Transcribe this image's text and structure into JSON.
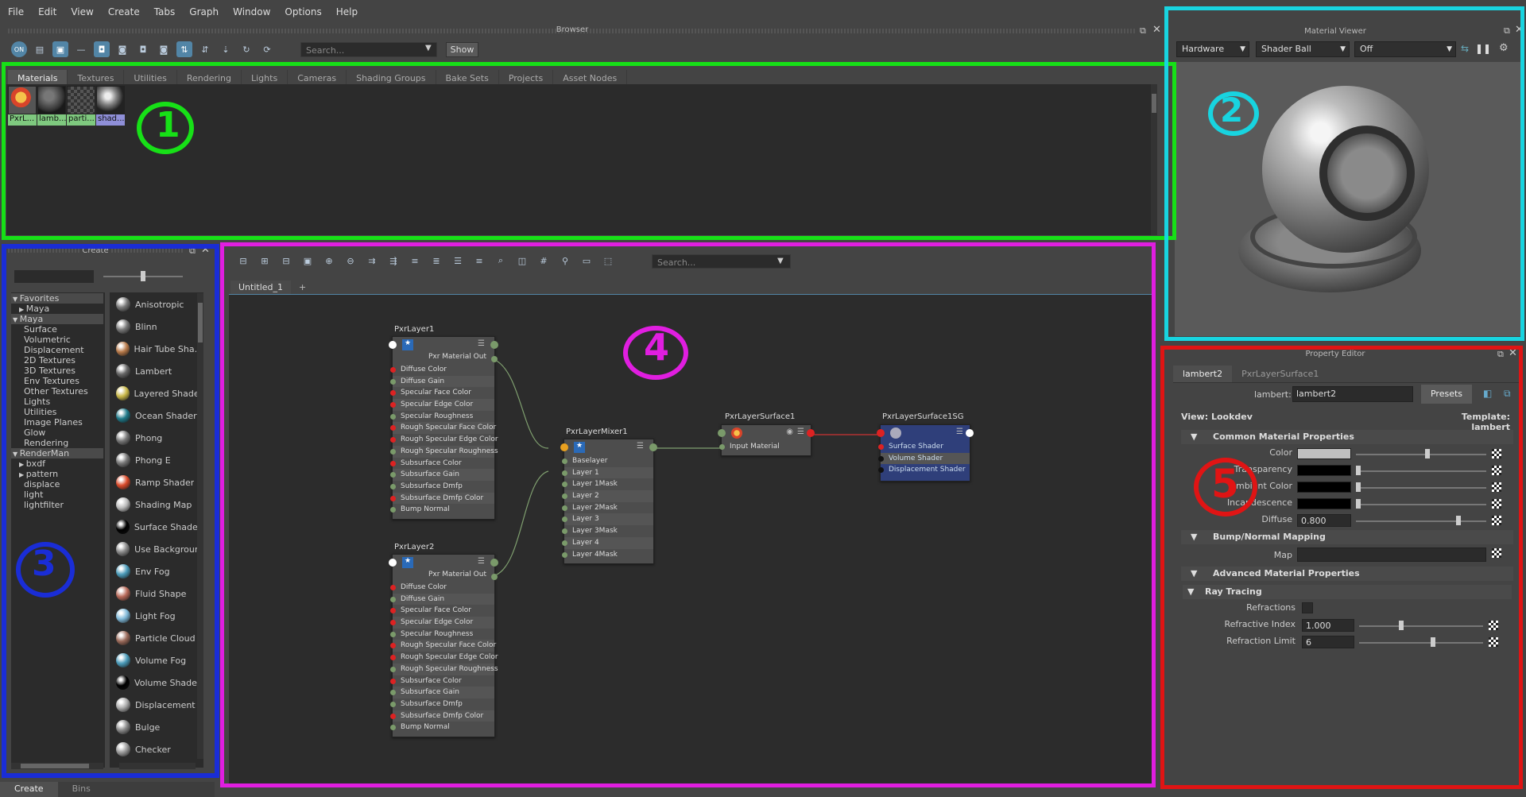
{
  "menu": [
    "File",
    "Edit",
    "View",
    "Create",
    "Tabs",
    "Graph",
    "Window",
    "Options",
    "Help"
  ],
  "browser": {
    "title": "Browser",
    "search_placeholder": "Search...",
    "show_label": "Show",
    "tabs": [
      "Materials",
      "Textures",
      "Utilities",
      "Rendering",
      "Lights",
      "Cameras",
      "Shading Groups",
      "Bake Sets",
      "Projects",
      "Asset Nodes"
    ],
    "swatches": [
      {
        "label": "PxrL...",
        "bg": "#7fc97f"
      },
      {
        "label": "lamb...",
        "bg": "#7fc97f"
      },
      {
        "label": "parti...",
        "bg": "#7fc97f"
      },
      {
        "label": "shad...",
        "bg": "#8f8fd8"
      }
    ]
  },
  "material_viewer": {
    "title": "Material Viewer",
    "renderer": "Hardware",
    "shape": "Shader Ball",
    "env": "Off"
  },
  "create_panel": {
    "title": "Create",
    "tree": [
      {
        "label": "Favorites",
        "level": 0,
        "expanded": true
      },
      {
        "label": "Maya",
        "level": 1,
        "expanded": false
      },
      {
        "label": "Maya",
        "level": 0,
        "expanded": true
      },
      {
        "label": "Surface",
        "level": 2
      },
      {
        "label": "Volumetric",
        "level": 2
      },
      {
        "label": "Displacement",
        "level": 2
      },
      {
        "label": "2D Textures",
        "level": 2
      },
      {
        "label": "3D Textures",
        "level": 2
      },
      {
        "label": "Env Textures",
        "level": 2
      },
      {
        "label": "Other Textures",
        "level": 2
      },
      {
        "label": "Lights",
        "level": 2
      },
      {
        "label": "Utilities",
        "level": 2
      },
      {
        "label": "Image Planes",
        "level": 2
      },
      {
        "label": "Glow",
        "level": 2
      },
      {
        "label": "Rendering",
        "level": 2
      },
      {
        "label": "RenderMan",
        "level": 0,
        "expanded": true
      },
      {
        "label": "bxdf",
        "level": 1,
        "expanded": false
      },
      {
        "label": "pattern",
        "level": 1,
        "expanded": false
      },
      {
        "label": "displace",
        "level": 2
      },
      {
        "label": "light",
        "level": 2
      },
      {
        "label": "lightfilter",
        "level": 2
      }
    ],
    "nodes": [
      {
        "label": "Anisotropic",
        "color": "#777"
      },
      {
        "label": "Blinn",
        "color": "#777"
      },
      {
        "label": "Hair Tube Sha...",
        "color": "#b87a4a"
      },
      {
        "label": "Lambert",
        "color": "#666"
      },
      {
        "label": "Layered Shader",
        "color": "#c9b84a"
      },
      {
        "label": "Ocean Shader",
        "color": "#1f7a8a"
      },
      {
        "label": "Phong",
        "color": "#777"
      },
      {
        "label": "Phong E",
        "color": "#777"
      },
      {
        "label": "Ramp Shader",
        "color": "#d94a2a"
      },
      {
        "label": "Shading Map",
        "color": "#bbb"
      },
      {
        "label": "Surface Shader",
        "color": "#000"
      },
      {
        "label": "Use Backgroun",
        "color": "#888"
      },
      {
        "label": "Env Fog",
        "color": "#4a9ab8"
      },
      {
        "label": "Fluid Shape",
        "color": "#b86a5a"
      },
      {
        "label": "Light Fog",
        "color": "#7fb8d8"
      },
      {
        "label": "Particle Cloud",
        "color": "#9a6a5a"
      },
      {
        "label": "Volume Fog",
        "color": "#4a9ab8"
      },
      {
        "label": "Volume Shader",
        "color": "#000"
      },
      {
        "label": "Displacement",
        "color": "#aaa"
      },
      {
        "label": "Bulge",
        "color": "#888"
      },
      {
        "label": "Checker",
        "color": "#999"
      }
    ],
    "bottom_tabs": [
      "Create",
      "Bins"
    ]
  },
  "node_editor": {
    "search_placeholder": "Search...",
    "tabs": [
      "Untitled_1",
      "+"
    ],
    "nodes": {
      "layer1": {
        "title": "PxrLayer1",
        "out": "Pxr Material Out",
        "attrs": [
          "Diffuse Color",
          "Diffuse Gain",
          "Specular Face Color",
          "Specular Edge Color",
          "Specular Roughness",
          "Rough Specular Face Color",
          "Rough Specular Edge Color",
          "Rough Specular Roughness",
          "Subsurface Color",
          "Subsurface Gain",
          "Subsurface Dmfp",
          "Subsurface Dmfp Color",
          "Bump Normal"
        ]
      },
      "layer2": {
        "title": "PxrLayer2",
        "out": "Pxr Material Out",
        "attrs": [
          "Diffuse Color",
          "Diffuse Gain",
          "Specular Face Color",
          "Specular Edge Color",
          "Specular Roughness",
          "Rough Specular Face Color",
          "Rough Specular Edge Color",
          "Rough Specular Roughness",
          "Subsurface Color",
          "Subsurface Gain",
          "Subsurface Dmfp",
          "Subsurface Dmfp Color",
          "Bump Normal"
        ]
      },
      "mixer": {
        "title": "PxrLayerMixer1",
        "attrs": [
          "Baselayer",
          "Layer 1",
          "Layer 1Mask",
          "Layer 2",
          "Layer 2Mask",
          "Layer 3",
          "Layer 3Mask",
          "Layer 4",
          "Layer 4Mask"
        ]
      },
      "surface": {
        "title": "PxrLayerSurface1",
        "attrs": [
          "Input Material"
        ]
      },
      "sg": {
        "title": "PxrLayerSurface1SG",
        "attrs": [
          "Surface Shader",
          "Volume Shader",
          "Displacement Shader"
        ]
      }
    }
  },
  "property_editor": {
    "title": "Property Editor",
    "tabs": [
      "lambert2",
      "PxrLayerSurface1"
    ],
    "type_label": "lambert:",
    "name_value": "lambert2",
    "presets_label": "Presets",
    "view_label": "View: Lookdev",
    "template_label": "Template: lambert",
    "sections": {
      "common": "Common Material Properties",
      "bump": "Bump/Normal Mapping",
      "advanced": "Advanced Material Properties",
      "ray": "Ray Tracing"
    },
    "common_props": [
      {
        "label": "Color",
        "swatch": "#c0c0c0",
        "level": 0.55
      },
      {
        "label": "Transparency",
        "swatch": "#000000",
        "level": 0.0
      },
      {
        "label": "Ambient Color",
        "swatch": "#000000",
        "level": 0.0
      },
      {
        "label": "Incandescence",
        "swatch": "#000000",
        "level": 0.0
      },
      {
        "label": "Diffuse",
        "value": "0.800",
        "level": 0.8
      }
    ],
    "bump_map_label": "Map",
    "ray_props": [
      {
        "label": "Refractions"
      },
      {
        "label": "Refractive Index",
        "value": "1.000",
        "level": 0.33
      },
      {
        "label": "Refraction Limit",
        "value": "6",
        "level": 0.6
      }
    ]
  },
  "annotations": [
    "1",
    "2",
    "3",
    "4",
    "5"
  ]
}
